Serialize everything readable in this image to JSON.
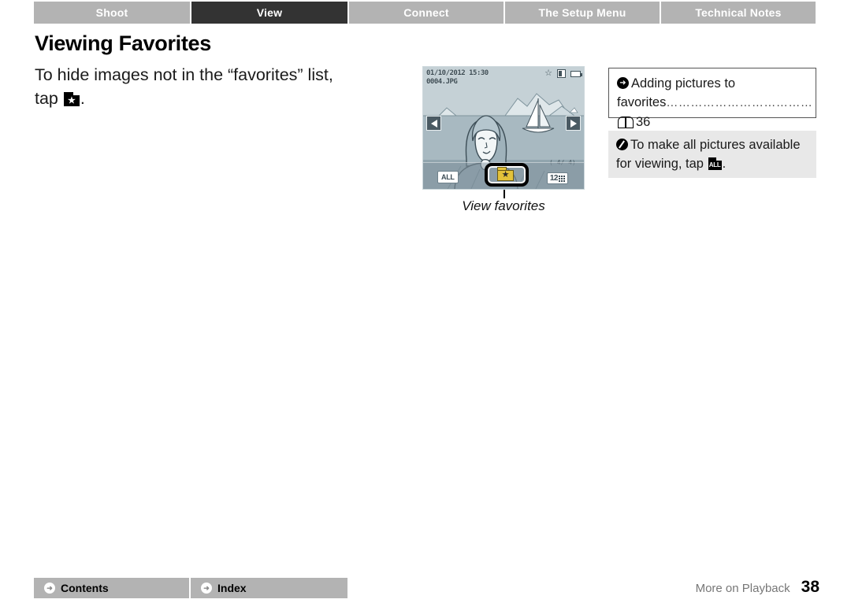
{
  "tabs": [
    {
      "label": "Shoot",
      "active": false
    },
    {
      "label": "View",
      "active": true
    },
    {
      "label": "Connect",
      "active": false
    },
    {
      "label": "The Setup Menu",
      "active": false
    },
    {
      "label": "Technical Notes",
      "active": false
    }
  ],
  "heading": "Viewing Favorites",
  "body": {
    "line1": "To hide images not in the “favorites” list,",
    "line2_pre": "tap",
    "line2_post": ".",
    "favorites_icon_glyph": "★"
  },
  "camera_screen": {
    "datetime": "01/10/2012  15:30",
    "filename": "0004.JPG",
    "top_right_icons": [
      "star-outline-icon",
      "print-mark-icon",
      "battery-icon"
    ],
    "left_arrow": "◀",
    "right_arrow": "▶",
    "toolbar": {
      "all_label": "ALL",
      "favorites_glyph": "★",
      "thumbnail_count": "12"
    },
    "caption": "View favorites"
  },
  "reference_box": {
    "arrow_icon": "right-arrow-circle-icon",
    "line1": "Adding pictures to",
    "line2": "favorites",
    "dots": "………………………………",
    "book_icon": "book-icon",
    "page": "36"
  },
  "note_box": {
    "pencil_icon": "pencil-note-icon",
    "line1": "To make all pictures available",
    "line2_pre": "for viewing, tap",
    "line2_post": ".",
    "all_icon_label": "ALL"
  },
  "footer": {
    "nav": [
      {
        "label": "Contents",
        "icon": "right-arrow-circle-icon"
      },
      {
        "label": "Index",
        "icon": "right-arrow-circle-icon"
      }
    ],
    "section_label": "More on Playback",
    "page_number": "38"
  },
  "colors": {
    "tab_inactive": "#b3b3b3",
    "tab_active": "#333333",
    "note_bg": "#e8e8e8",
    "favorite_yellow": "#e3c23a",
    "lcd_bg": "#b9c7cd"
  }
}
